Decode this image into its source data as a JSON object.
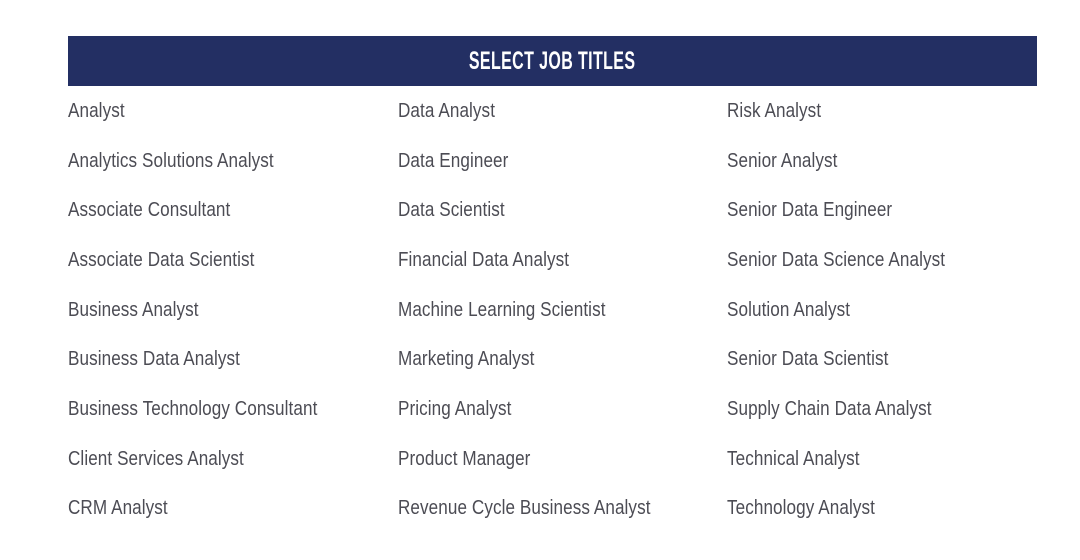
{
  "header": {
    "title": "SELECT JOB TITLES",
    "background_color": "#232f63",
    "text_color": "#ffffff"
  },
  "page": {
    "background_color": "#ffffff",
    "text_color": "#4c4c54"
  },
  "job_titles": {
    "column_count": 3,
    "row_count": 9,
    "columns": [
      {
        "index": 1,
        "items": [
          "Analyst",
          "Analytics Solutions Analyst",
          "Associate Consultant",
          "Associate Data Scientist",
          "Business Analyst",
          "Business Data Analyst",
          "Business Technology Consultant",
          "Client Services Analyst",
          "CRM Analyst"
        ]
      },
      {
        "index": 2,
        "items": [
          "Data Analyst",
          "Data Engineer",
          "Data Scientist",
          "Financial Data Analyst",
          "Machine Learning Scientist",
          "Marketing Analyst",
          "Pricing Analyst",
          "Product Manager",
          "Revenue Cycle Business Analyst"
        ]
      },
      {
        "index": 3,
        "items": [
          "Risk Analyst",
          "Senior Analyst",
          "Senior Data Engineer",
          "Senior Data Science Analyst",
          "Solution Analyst",
          "Senior Data Scientist",
          "Supply Chain Data Analyst",
          "Technical Analyst",
          "Technology Analyst"
        ]
      }
    ],
    "rows": [
      [
        "Analyst",
        "Data Analyst",
        "Risk Analyst"
      ],
      [
        "Analytics Solutions Analyst",
        "Data Engineer",
        "Senior Analyst"
      ],
      [
        "Associate Consultant",
        "Data Scientist",
        "Senior Data Engineer"
      ],
      [
        "Associate Data Scientist",
        "Financial Data Analyst",
        "Senior Data Science Analyst"
      ],
      [
        "Business Analyst",
        "Machine Learning Scientist",
        "Solution Analyst"
      ],
      [
        "Business Data Analyst",
        "Marketing Analyst",
        "Senior Data Scientist"
      ],
      [
        "Business Technology Consultant",
        "Pricing Analyst",
        "Supply Chain Data Analyst"
      ],
      [
        "Client Services Analyst",
        "Product Manager",
        "Technical Analyst"
      ],
      [
        "CRM Analyst",
        "Revenue Cycle Business Analyst",
        "Technology Analyst"
      ]
    ]
  }
}
